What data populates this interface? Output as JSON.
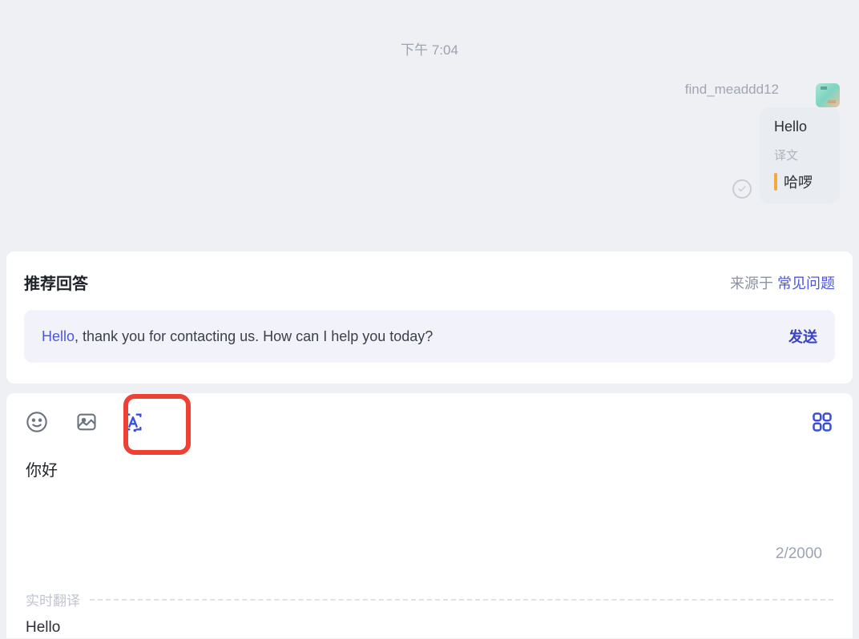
{
  "chat": {
    "timestamp": "下午 7:04",
    "message": {
      "sender": "find_meaddd12",
      "original": "Hello",
      "translation_label": "译文",
      "translated": "哈啰"
    }
  },
  "recommend": {
    "title": "推荐回答",
    "source_prefix": "来源于 ",
    "source_link": "常见问题",
    "suggestion_highlight": "Hello",
    "suggestion_rest": ", thank you for contacting us. How can I help you today?",
    "send_label": "发送"
  },
  "composer": {
    "input_value": "你好",
    "char_count": "2/2000",
    "realtime_label": "实时翻译",
    "translated_value": "Hello"
  },
  "icons": {
    "emoji": "emoji-icon",
    "image": "image-icon",
    "translate": "translate-icon",
    "grid": "grid-icon",
    "check": "check-icon"
  }
}
